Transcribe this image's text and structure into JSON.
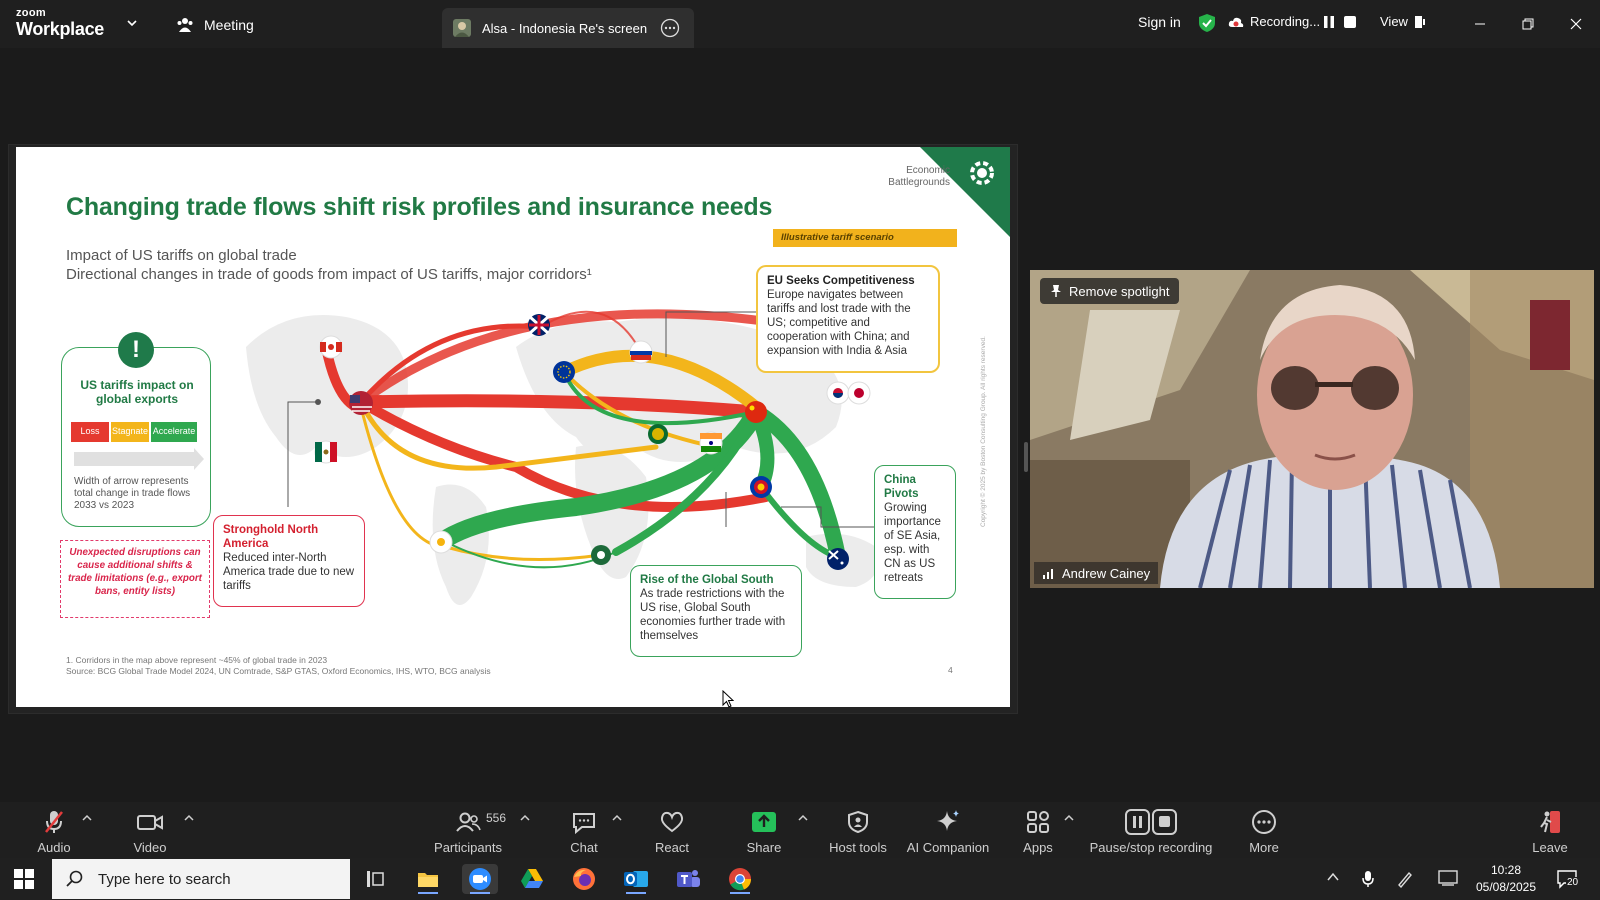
{
  "app": {
    "brand_small": "zoom",
    "brand_big": "Workplace",
    "meeting_label": "Meeting",
    "share_tab": "Alsa - Indonesia Re's screen",
    "sign_in": "Sign in",
    "recording_label": "Recording...",
    "view_label": "View"
  },
  "slide": {
    "corner_label": "Economic Battlegrounds",
    "title": "Changing trade flows shift risk profiles and insurance needs",
    "subtitle1": "Impact of US tariffs on global trade",
    "subtitle2": "Directional changes in trade of goods from impact of US tariffs, major corridors¹",
    "badge": "Illustrative tariff scenario",
    "legend": {
      "title": "US tariffs impact on global exports",
      "loss": "Loss",
      "stagnate": "Stagnate",
      "accelerate": "Accelerate",
      "note": "Width of arrow represents total change in trade flows 2033 vs 2023",
      "colors": {
        "loss": "#e5392f",
        "stagnate": "#f3b51b",
        "accelerate": "#2fa84f"
      }
    },
    "disruption_note": "Unexpected disruptions can cause additional shifts & trade limitations (e.g., export bans, entity lists)",
    "callouts": {
      "na_title": "Stronghold North America",
      "na_text": "Reduced inter-North America trade due to new tariffs",
      "eu_title": "EU Seeks Competitiveness",
      "eu_text": "Europe navigates between tariffs and lost trade with the US; competitive and cooperation with China; and expansion with India & Asia",
      "gs_title": "Rise of the Global South",
      "gs_text": "As trade restrictions with the US rise, Global South economies further trade with themselves",
      "cn_title": "China Pivots",
      "cn_text": "Growing importance of SE Asia, esp. with CN as US retreats"
    },
    "footnote1": "1. Corridors in the map above represent ~45% of global trade in 2023",
    "footnote2": "Source: BCG Global Trade Model 2024, UN Comtrade, S&P GTAS, Oxford Economics, IHS, WTO, BCG analysis",
    "page_number": "4",
    "copyright": "Copyright © 2025 by Boston Consulting Group. All rights reserved."
  },
  "video": {
    "spotlight_button": "Remove spotlight",
    "participant_name": "Andrew Cainey"
  },
  "controls": {
    "audio": "Audio",
    "video": "Video",
    "participants": "Participants",
    "participants_count": "556",
    "chat": "Chat",
    "react": "React",
    "share": "Share",
    "host_tools": "Host tools",
    "ai_companion": "AI Companion",
    "apps": "Apps",
    "pause_stop": "Pause/stop recording",
    "more": "More",
    "leave": "Leave"
  },
  "taskbar": {
    "search_placeholder": "Type here to search",
    "time": "10:28",
    "date": "05/08/2025",
    "notifications": "20"
  }
}
